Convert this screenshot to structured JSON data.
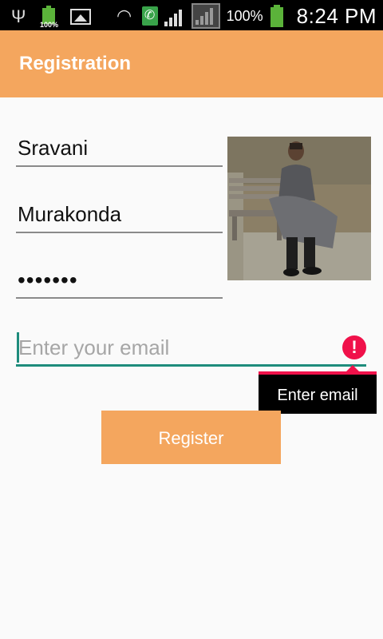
{
  "status_bar": {
    "battery_small_label": "100%",
    "battery_percent": "100%",
    "time": "8:24 PM"
  },
  "app_bar": {
    "title": "Registration",
    "color": "#f4a65e"
  },
  "form": {
    "first_name": "Sravani",
    "last_name": "Murakonda",
    "password_masked": "•••••••",
    "email_placeholder": "Enter your email",
    "email_error": "Enter email",
    "register_label": "Register"
  },
  "colors": {
    "accent": "#f4a65e",
    "focus": "#1e8c7c",
    "error": "#f0114a"
  },
  "icons": {
    "usb": "usb-icon",
    "battery": "battery-icon",
    "gallery": "image-icon",
    "wifi": "wifi-icon",
    "call": "call-icon",
    "signal": "signal-icon",
    "error": "error-icon"
  }
}
